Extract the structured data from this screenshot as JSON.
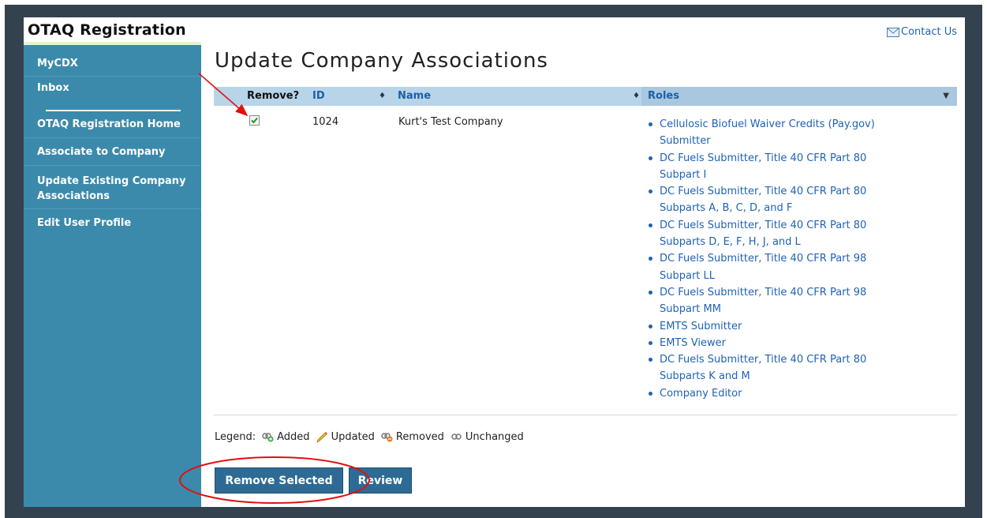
{
  "app": {
    "title": "OTAQ Registration"
  },
  "header": {
    "contact_label": "Contact Us"
  },
  "sidebar": {
    "items": [
      {
        "label": "MyCDX"
      },
      {
        "label": "Inbox"
      },
      {
        "label": "OTAQ Registration Home"
      },
      {
        "label": "Associate to Company"
      },
      {
        "label": "Update Existing Company Associations"
      },
      {
        "label": "Edit User Profile"
      }
    ]
  },
  "main": {
    "title": "Update Company Associations",
    "table": {
      "columns": {
        "remove": "Remove?",
        "id": "ID",
        "name": "Name",
        "roles": "Roles"
      },
      "rows": [
        {
          "checked": true,
          "id": "1024",
          "name": "Kurt's Test Company",
          "roles": [
            "Cellulosic Biofuel Waiver Credits (Pay.gov) Submitter",
            "DC Fuels Submitter, Title 40 CFR Part 80 Subpart I",
            "DC Fuels Submitter, Title 40 CFR Part 80 Subparts A, B, C, D, and F",
            "DC Fuels Submitter, Title 40 CFR Part 80 Subparts D, E, F, H, J, and L",
            "DC Fuels Submitter, Title 40 CFR Part 98 Subpart LL",
            "DC Fuels Submitter, Title 40 CFR Part 98 Subpart MM",
            "EMTS Submitter",
            "EMTS Viewer",
            "DC Fuels Submitter, Title 40 CFR Part 80 Subparts K and M",
            "Company Editor"
          ]
        }
      ]
    },
    "legend": {
      "label": "Legend:",
      "added": "Added",
      "updated": "Updated",
      "removed": "Removed",
      "unchanged": "Unchanged"
    },
    "buttons": {
      "remove_selected": "Remove Selected",
      "review": "Review"
    }
  },
  "colors": {
    "sidebar": "#3b8aab",
    "header_row": "#b8d4e8",
    "link": "#1f62b5",
    "button": "#2e6b94",
    "annotation": "#e01010"
  }
}
